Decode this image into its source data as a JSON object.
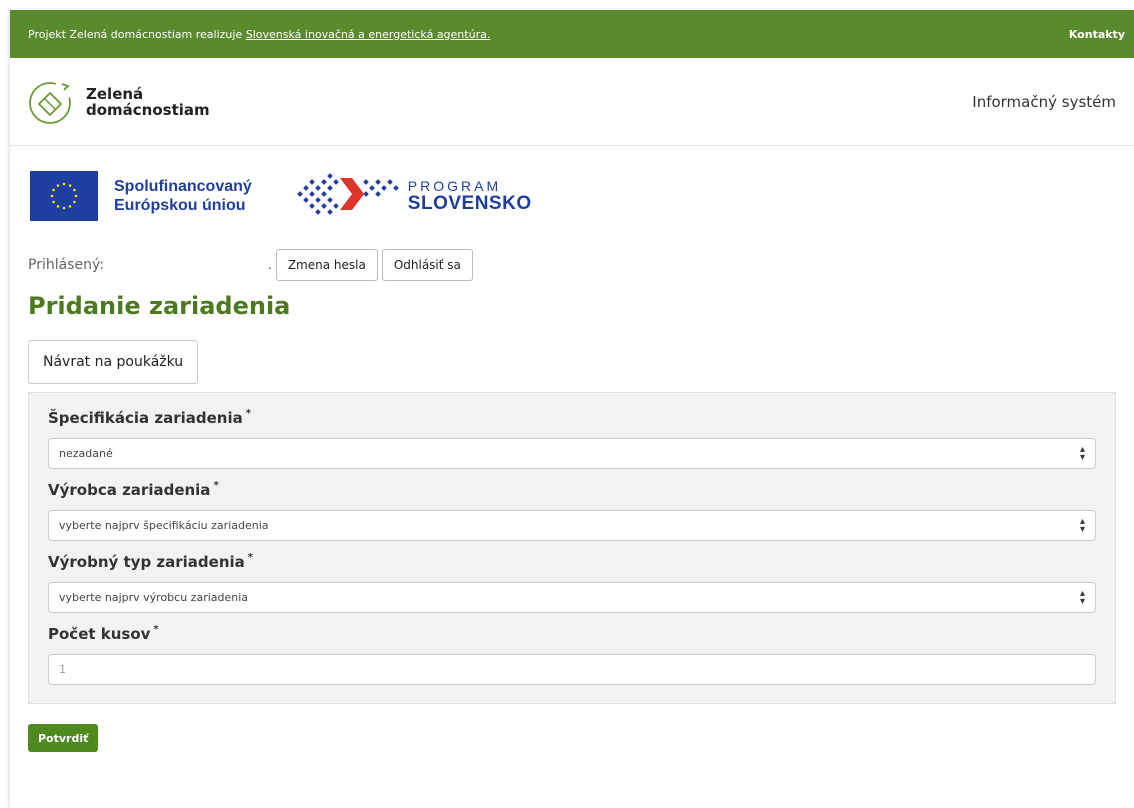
{
  "topbar": {
    "text": "Projekt Zelená domácnostiam realizuje ",
    "link": "Slovenská inovačná a energetická agentúra.",
    "contacts": "Kontakty"
  },
  "header": {
    "brand_line1": "Zelená",
    "brand_line2": "domácnostiam",
    "info_system": "Informačný systém"
  },
  "logos": {
    "eu_line1": "Spolufinancovaný",
    "eu_line2": "Európskou úniou",
    "program_line1": "PROGRAM",
    "program_line2": "SLOVENSKO"
  },
  "login": {
    "label": "Prihlásený:",
    "user": ".",
    "change_password": "Zmena hesla",
    "logout": "Odhlásiť sa"
  },
  "page": {
    "title": "Pridanie zariadenia",
    "back_button": "Návrat na poukážku"
  },
  "form": {
    "spec_label": "Špecifikácia zariadenia",
    "spec_value": "nezadané",
    "manufacturer_label": "Výrobca zariadenia",
    "manufacturer_value": "vyberte najprv špecifikáciu zariadenia",
    "type_label": "Výrobný typ zariadenia",
    "type_value": "vyberte najprv výrobcu zariadenia",
    "count_label": "Počet kusov",
    "count_value": "1",
    "required_mark": "*",
    "submit": "Potvrdiť"
  },
  "colors": {
    "brand_green": "#5a8a2e",
    "title_green": "#4b7a1f",
    "eu_blue": "#1f3fa0",
    "ps_red": "#e0342a"
  }
}
